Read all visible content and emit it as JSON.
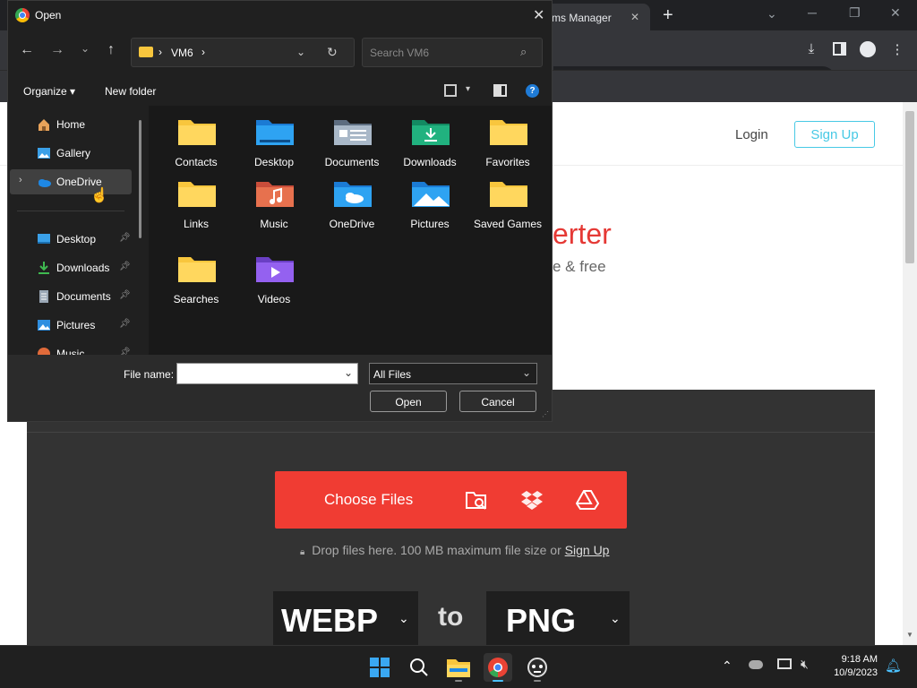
{
  "browser": {
    "tab_title": "ms Manager",
    "new_tab": "+",
    "win_min": "─",
    "win_max": "❐",
    "win_close": "✕",
    "tab_close": "✕"
  },
  "page": {
    "login": "Login",
    "signup": "Sign Up",
    "hero_title_partial": "erter",
    "hero_sub_partial": "e & free",
    "choose_files": "Choose Files",
    "drop_text": "Drop files here. 100 MB maximum file size or",
    "drop_link": "Sign Up",
    "from_format": "WEBP",
    "to_word": "to",
    "to_format": "PNG"
  },
  "dialog": {
    "title": "Open",
    "breadcrumb": "VM6",
    "search_placeholder": "Search VM6",
    "organize": "Organize",
    "new_folder": "New folder",
    "sidebar": [
      {
        "label": "Home",
        "icon": "home-icon",
        "pinned": false
      },
      {
        "label": "Gallery",
        "icon": "gallery-icon",
        "pinned": false
      },
      {
        "label": "OneDrive",
        "icon": "onedrive-icon",
        "pinned": false,
        "selected": true
      },
      {
        "label": "Desktop",
        "icon": "desktop-icon",
        "pinned": true
      },
      {
        "label": "Downloads",
        "icon": "downloads-icon",
        "pinned": true
      },
      {
        "label": "Documents",
        "icon": "documents-icon",
        "pinned": true
      },
      {
        "label": "Pictures",
        "icon": "pictures-icon",
        "pinned": true
      },
      {
        "label": "Music",
        "icon": "music-icon",
        "pinned": true
      }
    ],
    "folders": [
      {
        "label": "Contacts",
        "icon": "folder-icon"
      },
      {
        "label": "Desktop",
        "icon": "desktop-folder-icon"
      },
      {
        "label": "Documents",
        "icon": "documents-folder-icon"
      },
      {
        "label": "Downloads",
        "icon": "downloads-folder-icon"
      },
      {
        "label": "Favorites",
        "icon": "folder-icon"
      },
      {
        "label": "Links",
        "icon": "folder-icon"
      },
      {
        "label": "Music",
        "icon": "music-folder-icon"
      },
      {
        "label": "OneDrive",
        "icon": "onedrive-folder-icon"
      },
      {
        "label": "Pictures",
        "icon": "pictures-folder-icon"
      },
      {
        "label": "Saved Games",
        "icon": "folder-icon"
      },
      {
        "label": "Searches",
        "icon": "folder-icon"
      },
      {
        "label": "Videos",
        "icon": "videos-folder-icon"
      }
    ],
    "file_name_label": "File name:",
    "file_name_value": "",
    "file_type": "All Files",
    "open_button": "Open",
    "cancel_button": "Cancel"
  },
  "taskbar": {
    "time": "9:18 AM",
    "date": "10/9/2023"
  },
  "colors": {
    "accent_red": "#f03c33",
    "signup_blue": "#47c9e5",
    "folder_yellow": "#f8c63d",
    "dialog_bg": "#202020"
  }
}
